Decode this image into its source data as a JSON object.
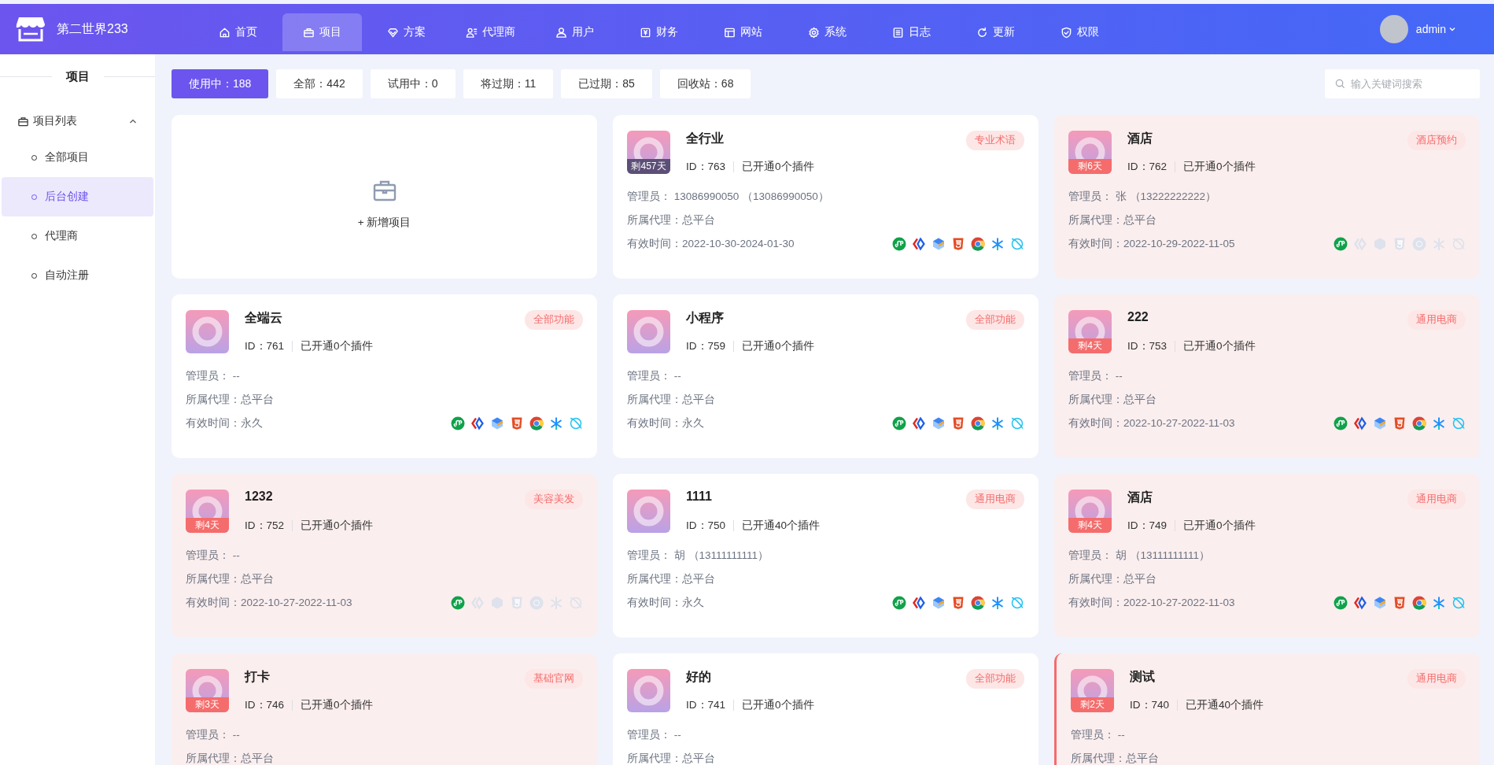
{
  "brand": {
    "name": "第二世界233"
  },
  "nav": [
    {
      "kind": "home",
      "label": "首页",
      "selected": false
    },
    {
      "kind": "briefcase",
      "label": "项目",
      "selected": true
    },
    {
      "kind": "gem",
      "label": "方案",
      "selected": false
    },
    {
      "kind": "agent",
      "label": "代理商",
      "selected": false
    },
    {
      "kind": "users",
      "label": "用户",
      "selected": false
    },
    {
      "kind": "finance",
      "label": "财务",
      "selected": false
    },
    {
      "kind": "site",
      "label": "网站",
      "selected": false
    },
    {
      "kind": "gear",
      "label": "系统",
      "selected": false
    },
    {
      "kind": "log",
      "label": "日志",
      "selected": false
    },
    {
      "kind": "refresh",
      "label": "更新",
      "selected": false
    },
    {
      "kind": "shield",
      "label": "权限",
      "selected": false
    }
  ],
  "user": {
    "name": "admin"
  },
  "sidebar": {
    "title": "项目",
    "group": {
      "label": "项目列表",
      "expanded": true,
      "children": [
        {
          "label": "全部项目",
          "selected": false
        },
        {
          "label": "后台创建",
          "selected": true
        },
        {
          "label": "代理商",
          "selected": false
        },
        {
          "label": "自动注册",
          "selected": false
        }
      ]
    }
  },
  "filters": [
    {
      "label": "使用中：188",
      "selected": true
    },
    {
      "label": "全部：442",
      "selected": false
    },
    {
      "label": "试用中：0",
      "selected": false
    },
    {
      "label": "将过期：11",
      "selected": false
    },
    {
      "label": "已过期：85",
      "selected": false
    },
    {
      "label": "回收站：68",
      "selected": false
    }
  ],
  "search": {
    "placeholder": "输入关键词搜索"
  },
  "add_card": {
    "label": "+ 新增项目"
  },
  "cards": [
    {
      "title": "全行业",
      "tag": "专业术语",
      "remaining": "剩457天",
      "expiring": false,
      "selected": false,
      "id": "ID：763",
      "plugins_text": "已开通0个插件",
      "admin_label": "管理员：",
      "admin": "13086990050 （13086990050）",
      "agent_label": "所属代理：",
      "agent": "总平台",
      "valid_label": "有效时间：",
      "valid": "2022-10-30-2024-01-30",
      "plugins": [
        {
          "kind": "mini",
          "on": true
        },
        {
          "kind": "code",
          "on": true
        },
        {
          "kind": "layers",
          "on": true
        },
        {
          "kind": "html5",
          "on": true
        },
        {
          "kind": "chrome",
          "on": true
        },
        {
          "kind": "star",
          "on": true
        },
        {
          "kind": "planet",
          "on": true
        }
      ]
    },
    {
      "title": "酒店",
      "tag": "酒店预约",
      "remaining": "剩6天",
      "expiring": true,
      "selected": false,
      "id": "ID：762",
      "plugins_text": "已开通0个插件",
      "admin_label": "管理员：",
      "admin": "张 （13222222222）",
      "agent_label": "所属代理：",
      "agent": "总平台",
      "valid_label": "有效时间：",
      "valid": "2022-10-29-2022-11-05",
      "plugins": [
        {
          "kind": "mini",
          "on": true
        },
        {
          "kind": "code",
          "on": false
        },
        {
          "kind": "layers",
          "on": false
        },
        {
          "kind": "html5",
          "on": false
        },
        {
          "kind": "chrome",
          "on": false
        },
        {
          "kind": "star",
          "on": false
        },
        {
          "kind": "planet",
          "on": false
        }
      ]
    },
    {
      "title": "全端云",
      "tag": "全部功能",
      "expiring": false,
      "selected": false,
      "id": "ID：761",
      "plugins_text": "已开通0个插件",
      "admin_label": "管理员：",
      "admin": "--",
      "agent_label": "所属代理：",
      "agent": "总平台",
      "valid_label": "有效时间：",
      "valid": "永久",
      "plugins": [
        {
          "kind": "mini",
          "on": true
        },
        {
          "kind": "code",
          "on": true
        },
        {
          "kind": "layers",
          "on": true
        },
        {
          "kind": "html5",
          "on": true
        },
        {
          "kind": "chrome",
          "on": true
        },
        {
          "kind": "star",
          "on": true
        },
        {
          "kind": "planet",
          "on": true
        }
      ]
    },
    {
      "title": "小程序",
      "tag": "全部功能",
      "expiring": false,
      "selected": false,
      "id": "ID：759",
      "plugins_text": "已开通0个插件",
      "admin_label": "管理员：",
      "admin": "--",
      "agent_label": "所属代理：",
      "agent": "总平台",
      "valid_label": "有效时间：",
      "valid": "永久",
      "plugins": [
        {
          "kind": "mini",
          "on": true
        },
        {
          "kind": "code",
          "on": true
        },
        {
          "kind": "layers",
          "on": true
        },
        {
          "kind": "html5",
          "on": true
        },
        {
          "kind": "chrome",
          "on": true
        },
        {
          "kind": "star",
          "on": true
        },
        {
          "kind": "planet",
          "on": true
        }
      ]
    },
    {
      "title": "222",
      "tag": "通用电商",
      "remaining": "剩4天",
      "expiring": true,
      "selected": false,
      "id": "ID：753",
      "plugins_text": "已开通0个插件",
      "admin_label": "管理员：",
      "admin": "--",
      "agent_label": "所属代理：",
      "agent": "总平台",
      "valid_label": "有效时间：",
      "valid": "2022-10-27-2022-11-03",
      "plugins": [
        {
          "kind": "mini",
          "on": true
        },
        {
          "kind": "code",
          "on": true
        },
        {
          "kind": "layers",
          "on": true
        },
        {
          "kind": "html5",
          "on": true
        },
        {
          "kind": "chrome",
          "on": true
        },
        {
          "kind": "star",
          "on": true
        },
        {
          "kind": "planet",
          "on": true
        }
      ]
    },
    {
      "title": "1232",
      "tag": "美容美发",
      "remaining": "剩4天",
      "expiring": true,
      "selected": false,
      "id": "ID：752",
      "plugins_text": "已开通0个插件",
      "admin_label": "管理员：",
      "admin": "--",
      "agent_label": "所属代理：",
      "agent": "总平台",
      "valid_label": "有效时间：",
      "valid": "2022-10-27-2022-11-03",
      "plugins": [
        {
          "kind": "mini",
          "on": true
        },
        {
          "kind": "code",
          "on": false
        },
        {
          "kind": "layers",
          "on": false
        },
        {
          "kind": "html5",
          "on": false
        },
        {
          "kind": "chrome",
          "on": false
        },
        {
          "kind": "star",
          "on": false
        },
        {
          "kind": "planet",
          "on": false
        }
      ]
    },
    {
      "title": "1111",
      "tag": "通用电商",
      "expiring": false,
      "selected": false,
      "id": "ID：750",
      "plugins_text": "已开通40个插件",
      "admin_label": "管理员：",
      "admin": "胡 （13111111111）",
      "agent_label": "所属代理：",
      "agent": "总平台",
      "valid_label": "有效时间：",
      "valid": "永久",
      "plugins": [
        {
          "kind": "mini",
          "on": true
        },
        {
          "kind": "code",
          "on": true
        },
        {
          "kind": "layers",
          "on": true
        },
        {
          "kind": "html5",
          "on": true
        },
        {
          "kind": "chrome",
          "on": true
        },
        {
          "kind": "star",
          "on": true
        },
        {
          "kind": "planet",
          "on": true
        }
      ]
    },
    {
      "title": "酒店",
      "tag": "通用电商",
      "remaining": "剩4天",
      "expiring": true,
      "selected": false,
      "id": "ID：749",
      "plugins_text": "已开通0个插件",
      "admin_label": "管理员：",
      "admin": "胡 （13111111111）",
      "agent_label": "所属代理：",
      "agent": "总平台",
      "valid_label": "有效时间：",
      "valid": "2022-10-27-2022-11-03",
      "plugins": [
        {
          "kind": "mini",
          "on": true
        },
        {
          "kind": "code",
          "on": true
        },
        {
          "kind": "layers",
          "on": true
        },
        {
          "kind": "html5",
          "on": true
        },
        {
          "kind": "chrome",
          "on": true
        },
        {
          "kind": "star",
          "on": true
        },
        {
          "kind": "planet",
          "on": true
        }
      ]
    },
    {
      "title": "打卡",
      "tag": "基础官网",
      "remaining": "剩3天",
      "expiring": true,
      "selected": false,
      "id": "ID：746",
      "plugins_text": "已开通0个插件",
      "admin_label": "管理员：",
      "admin": "--",
      "agent_label": "所属代理：",
      "agent": "总平台"
    },
    {
      "title": "好的",
      "tag": "全部功能",
      "expiring": false,
      "selected": false,
      "id": "ID：741",
      "plugins_text": "已开通0个插件",
      "admin_label": "管理员：",
      "admin": "--",
      "agent_label": "所属代理：",
      "agent": "总平台"
    },
    {
      "title": "测试",
      "tag": "通用电商",
      "remaining": "剩2天",
      "expiring": true,
      "selected": true,
      "id": "ID：740",
      "plugins_text": "已开通40个插件",
      "admin_label": "管理员：",
      "admin": "--",
      "agent_label": "所属代理：",
      "agent": "总平台"
    }
  ]
}
